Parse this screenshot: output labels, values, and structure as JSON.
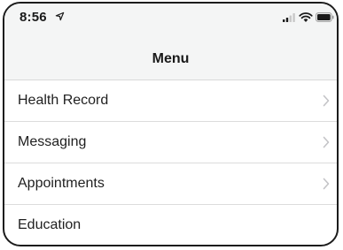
{
  "status_bar": {
    "time": "8:56",
    "icons": [
      "location-arrow-icon",
      "cellular-signal-icon",
      "wifi-icon",
      "battery-icon"
    ]
  },
  "nav": {
    "title": "Menu"
  },
  "menu": {
    "items": [
      {
        "label": "Health Record",
        "has_chevron": true
      },
      {
        "label": "Messaging",
        "has_chevron": true
      },
      {
        "label": "Appointments",
        "has_chevron": true
      },
      {
        "label": "Education",
        "has_chevron": false
      }
    ]
  },
  "colors": {
    "header_bg": "#f4f5f5",
    "text": "#1f1f1f",
    "divider": "#dcdcdc",
    "chevron": "#c4c4c7",
    "frame": "#1c1c1c"
  }
}
